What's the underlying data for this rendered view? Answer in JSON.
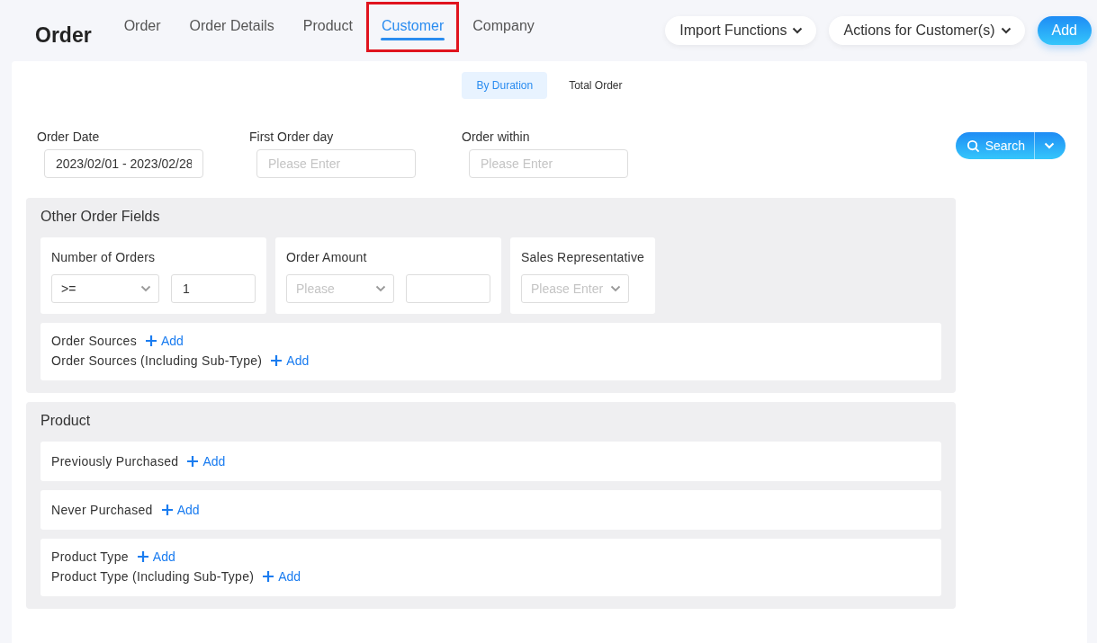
{
  "header": {
    "title": "Order",
    "tabs": [
      {
        "label": "Order",
        "selected": false,
        "annotated": false
      },
      {
        "label": "Order Details",
        "selected": false,
        "annotated": false
      },
      {
        "label": "Product",
        "selected": false,
        "annotated": false
      },
      {
        "label": "Customer",
        "selected": true,
        "annotated": true
      },
      {
        "label": "Company",
        "selected": false,
        "annotated": false
      }
    ],
    "menus": [
      "Import Functions",
      "Actions for Customer(s)"
    ],
    "add_button": "Add"
  },
  "view_toggle": [
    {
      "label": "By Duration",
      "selected": true
    },
    {
      "label": "Total Order",
      "selected": false
    }
  ],
  "filters": [
    {
      "label": "Order Date",
      "value": "2023/02/01 - 2023/02/28"
    },
    {
      "label": "First Order day",
      "placeholder": "Please Enter"
    },
    {
      "label": "Order within",
      "placeholder": "Please Enter"
    }
  ],
  "search_button": "Search",
  "sections": [
    {
      "title": "Other Order Fields",
      "cards": [
        {
          "label": "Number of Orders",
          "controls": [
            {
              "kind": "select",
              "value": ">="
            },
            {
              "kind": "input",
              "value": "1"
            }
          ]
        },
        {
          "label": "Order Amount",
          "controls": [
            {
              "kind": "select",
              "placeholder": "Please"
            },
            {
              "kind": "input"
            }
          ]
        },
        {
          "label": "Sales Representative",
          "controls": [
            {
              "kind": "select",
              "placeholder": "Please Enter"
            }
          ]
        }
      ],
      "groups": [
        [
          {
            "label": "Order Sources",
            "action": "Add"
          },
          {
            "label": "Order Sources (Including Sub-Type)",
            "action": "Add"
          }
        ]
      ]
    },
    {
      "title": "Product",
      "groups": [
        [
          {
            "label": "Previously Purchased",
            "action": "Add"
          }
        ],
        [
          {
            "label": "Never Purchased",
            "action": "Add"
          }
        ],
        [
          {
            "label": "Product Type",
            "action": "Add"
          },
          {
            "label": "Product Type (Including Sub-Type)",
            "action": "Add"
          }
        ]
      ]
    }
  ]
}
